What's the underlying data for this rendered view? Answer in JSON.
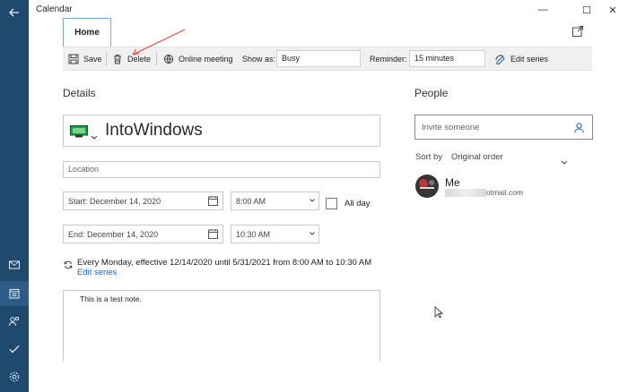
{
  "window": {
    "title": "Calendar"
  },
  "tabs": {
    "home": "Home"
  },
  "toolbar": {
    "save": "Save",
    "delete": "Delete",
    "online_meeting": "Online meeting",
    "show_as_label": "Show as:",
    "show_as_value": "Busy",
    "reminder_label": "Reminder:",
    "reminder_value": "15 minutes",
    "edit_series": "Edit series"
  },
  "details": {
    "heading": "Details",
    "title": "IntoWindows",
    "location_placeholder": "Location",
    "start_label": "Start:",
    "start_date": "December 14, 2020",
    "start_time": "8:00 AM",
    "end_label": "End:",
    "end_date": "December 14, 2020",
    "end_time": "10:30 AM",
    "all_day_label": "All day",
    "all_day_checked": false,
    "recurrence": "Every Monday, effective 12/14/2020 until 5/31/2021 from 8:00 AM to 10:30 AM",
    "edit_series_link": "Edit series",
    "notes": "This is a test note."
  },
  "people": {
    "heading": "People",
    "invite_placeholder": "Invite someone",
    "sort_label": "Sort by",
    "sort_value": "Original order",
    "attendee_name": "Me",
    "attendee_email_visible": "otmail.com"
  },
  "colors": {
    "rail": "#1f4a6e",
    "accent": "#1a67b8",
    "toolbar_bg": "#f0f0f0"
  },
  "icons": [
    "back-arrow-icon",
    "mail-icon",
    "calendar-icon",
    "people-icon",
    "todo-icon",
    "settings-icon",
    "save-icon",
    "delete-icon",
    "online-meeting-icon",
    "edit-series-icon",
    "calendar-picker-icon",
    "recurrence-icon",
    "person-icon",
    "chevron-down-icon",
    "popout-icon"
  ]
}
